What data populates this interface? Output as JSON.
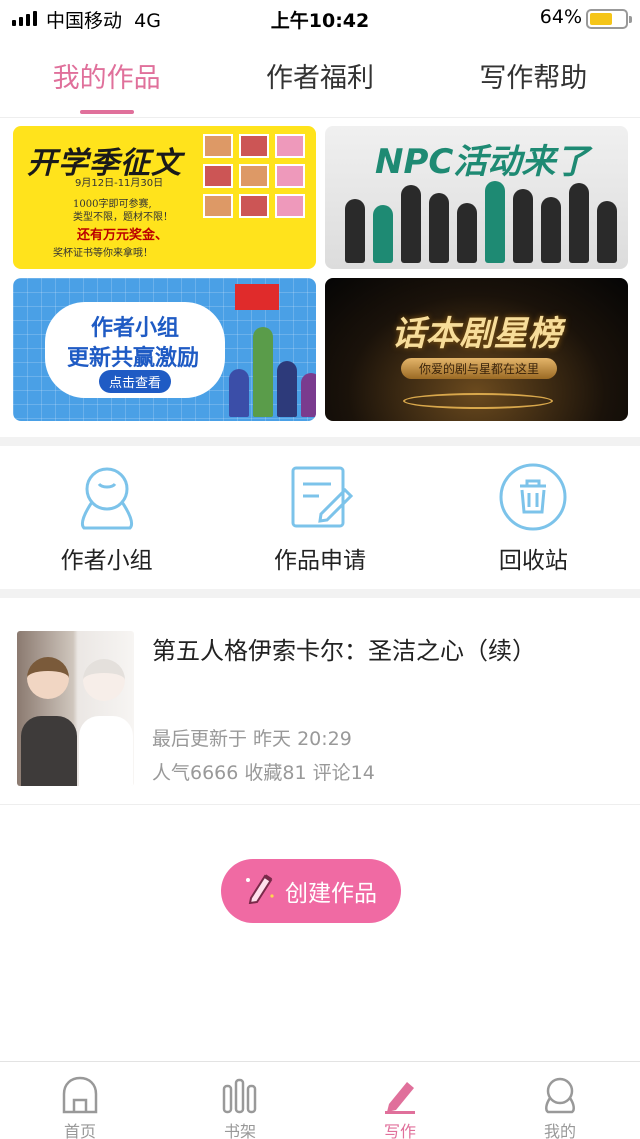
{
  "status_bar": {
    "carrier": "中国移动",
    "network": "4G",
    "time": "上午10:42",
    "battery_percent": "64%",
    "battery_level": 0.64
  },
  "tabs": [
    {
      "label": "我的作品",
      "active": true
    },
    {
      "label": "作者福利",
      "active": false
    },
    {
      "label": "写作帮助",
      "active": false
    }
  ],
  "banners": {
    "contest": {
      "title": "开学季征文",
      "date": "9月12日-11月30日",
      "desc1": "1000字即可参赛,",
      "desc2": "类型不限，题材不限！",
      "prize": "还有万元奖金、",
      "cert": "奖杯证书等你来拿哦！"
    },
    "npc": {
      "title": "NPC活动来了"
    },
    "group": {
      "line1": "作者小组",
      "line2": "更新共赢激励",
      "button": "点击查看"
    },
    "drama": {
      "title": "话本剧星榜",
      "sub": "你爱的剧与星都在这里"
    }
  },
  "quick_entries": [
    {
      "label": "作者小组",
      "icon": "author-group-icon"
    },
    {
      "label": "作品申请",
      "icon": "edit-document-icon"
    },
    {
      "label": "回收站",
      "icon": "trash-icon"
    }
  ],
  "work": {
    "title": "第五人格伊索卡尔：圣洁之心（续）",
    "updated": "最后更新于 昨天 20:29",
    "stats": "人气6666 收藏81 评论14"
  },
  "create_button": {
    "label": "创建作品",
    "icon": "pencil-icon"
  },
  "bottom_nav": [
    {
      "label": "首页",
      "icon": "home-icon",
      "active": false
    },
    {
      "label": "书架",
      "icon": "bookshelf-icon",
      "active": false
    },
    {
      "label": "写作",
      "icon": "pencil-icon",
      "active": true
    },
    {
      "label": "我的",
      "icon": "profile-icon",
      "active": false
    }
  ],
  "colors": {
    "accent": "#e0709b",
    "button": "#f06aa3",
    "icon_blue": "#7cc3ea"
  }
}
